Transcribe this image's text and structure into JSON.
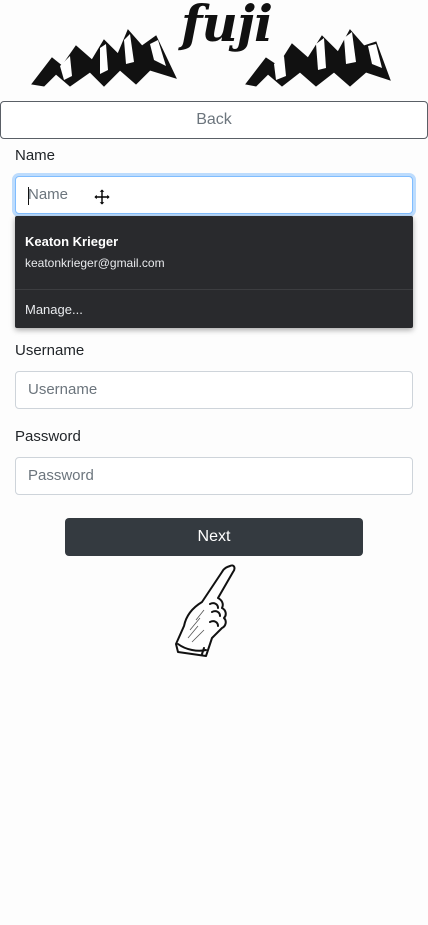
{
  "logo": {
    "text": "fuji",
    "icon": "mountains-logo"
  },
  "back_button": {
    "label": "Back"
  },
  "form": {
    "name": {
      "label": "Name",
      "placeholder": "Name",
      "value": ""
    },
    "username": {
      "label": "Username",
      "placeholder": "Username",
      "value": ""
    },
    "password": {
      "label": "Password",
      "placeholder": "Password",
      "value": ""
    },
    "next_label": "Next"
  },
  "autofill": {
    "entry_name": "Keaton Krieger",
    "entry_email": "keatonkrieger@gmail.com",
    "manage_label": "Manage..."
  },
  "colors": {
    "next_bg": "#343a40",
    "focus_border": "#80bdff",
    "autofill_bg": "#292a2d"
  },
  "icons": {
    "cursor": "move-cursor-icon",
    "pointer_hand": "pointing-hand-icon"
  }
}
